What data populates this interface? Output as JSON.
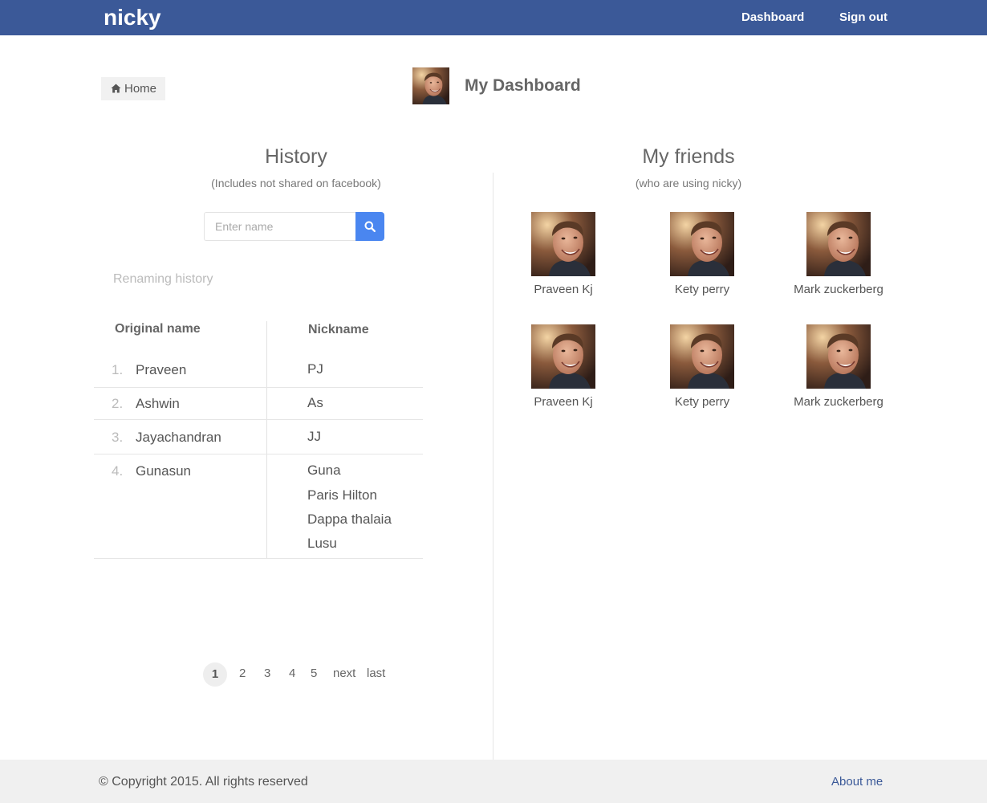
{
  "navbar": {
    "brand": "nicky",
    "links": [
      {
        "label": "Dashboard"
      },
      {
        "label": "Sign out"
      }
    ],
    "background": "#3b5998"
  },
  "breadcrumb": {
    "home_label": "Home",
    "icon": "home-icon"
  },
  "dashboard": {
    "title": "My Dashboard"
  },
  "history": {
    "title": "History",
    "subtitle": "(Includes not shared on facebook)",
    "search": {
      "placeholder": "Enter name",
      "value": "",
      "icon": "search-icon",
      "button_color": "#4a86f0"
    },
    "section_label": "Renaming history",
    "columns": [
      "Original name",
      "Nickname"
    ],
    "rows": [
      {
        "num": "1.",
        "name": "Praveen",
        "nicknames": [
          "PJ"
        ]
      },
      {
        "num": "2.",
        "name": "Ashwin",
        "nicknames": [
          "As"
        ]
      },
      {
        "num": "3.",
        "name": "Jayachandran",
        "nicknames": [
          "JJ"
        ]
      },
      {
        "num": "4.",
        "name": "Gunasun",
        "nicknames": [
          "Guna",
          "Paris Hilton",
          "Dappa thalaia",
          "Lusu"
        ]
      }
    ],
    "pagination": {
      "active": "1",
      "pages": [
        "2",
        "3",
        "4",
        "5"
      ],
      "next": "next",
      "last": "last"
    }
  },
  "friends": {
    "title": "My friends",
    "subtitle": "(who are using nicky)",
    "items": [
      {
        "name": "Praveen Kj"
      },
      {
        "name": "Kety perry"
      },
      {
        "name": "Mark zuckerberg"
      },
      {
        "name": "Praveen Kj"
      },
      {
        "name": "Kety perry"
      },
      {
        "name": "Mark zuckerberg"
      }
    ]
  },
  "footer": {
    "copyright": "© Copyright 2015. All rights reserved",
    "about": "About me"
  }
}
